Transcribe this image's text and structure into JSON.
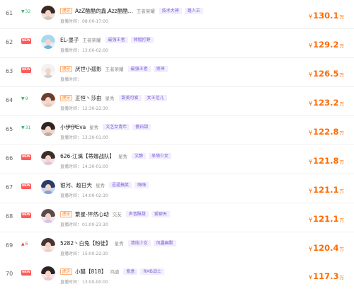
{
  "ranking": {
    "badge_text": "虎牙",
    "time_label": "直播时间：",
    "currency": "¥",
    "unit": "万",
    "rows": [
      {
        "rank": "61",
        "trend": "down",
        "trend_text": "32",
        "has_badge": true,
        "name": "AzZ酷酷的鑫,Azz酷酷...",
        "game": "王者荣耀",
        "tags": [
          "技术大神",
          "路人王"
        ],
        "time": "08:00-17:00",
        "value": "130.1",
        "avatar": "cute"
      },
      {
        "rank": "62",
        "trend": "new",
        "trend_text": "NEW",
        "has_badge": false,
        "name": "EL-墨子",
        "game": "王者荣耀",
        "tags": [
          "最强王者",
          "钟馗打野"
        ],
        "time": "13:00-02:00",
        "value": "129.2",
        "avatar": "cartoon"
      },
      {
        "rank": "63",
        "trend": "new",
        "trend_text": "NEW",
        "has_badge": true,
        "name": "厌世小孤影",
        "game": "王者荣耀",
        "tags": [
          "最强王者",
          "男神"
        ],
        "time": "",
        "value": "126.5",
        "avatar": "panda"
      },
      {
        "rank": "64",
        "trend": "down",
        "trend_text": "9",
        "has_badge": true,
        "name": "正恒丶莎由",
        "game": "星秀",
        "tags": [
          "甜美可爱",
          "女王范儿"
        ],
        "time": "12:30-22:30",
        "value": "123.2",
        "avatar": "girl"
      },
      {
        "rank": "65",
        "trend": "down",
        "trend_text": "31",
        "has_badge": false,
        "name": "小伊伊Eva",
        "game": "星秀",
        "tags": [
          "文艺女青年",
          "傲白甜"
        ],
        "time": "13:30-01:00",
        "value": "122.8",
        "avatar": "girl2"
      },
      {
        "rank": "66",
        "trend": "new",
        "trend_text": "NEW",
        "has_badge": false,
        "name": "626-江漓【蒂娜战队】",
        "game": "星秀",
        "tags": [
          "文静",
          "呆萌少女"
        ],
        "time": "14:30-01:00",
        "value": "121.8",
        "avatar": "girl3"
      },
      {
        "rank": "67",
        "trend": "new",
        "trend_text": "NEW",
        "has_badge": false,
        "name": "银河、超日天",
        "game": "星秀",
        "tags": [
          "逗逼搞笑",
          "嗨嗨"
        ],
        "time": "14:00-02:30",
        "value": "121.1",
        "avatar": "anime"
      },
      {
        "rank": "68",
        "trend": "new",
        "trend_text": "NEW",
        "has_badge": true,
        "name": "繁星-怦然心动",
        "game": "交友",
        "tags": [
          "声音酥甜",
          "爱聊天"
        ],
        "time": "01:00-23:30",
        "value": "121.1",
        "avatar": "girl4"
      },
      {
        "rank": "69",
        "trend": "up",
        "trend_text": "6",
        "has_badge": false,
        "name": "5282丶白兔【粉徒】",
        "game": "星秀",
        "tags": [
          "清纯少女",
          "风趣幽默"
        ],
        "time": "15:00-22:30",
        "value": "120.4",
        "avatar": "girl5"
      },
      {
        "rank": "70",
        "trend": "new",
        "trend_text": "NEW",
        "has_badge": true,
        "name": "小醋【818】",
        "game": "鸿道",
        "tags": [
          "瓶盒",
          "RMB战士"
        ],
        "time": "13:00-00:00",
        "value": "117.3",
        "avatar": "girl6"
      }
    ]
  }
}
